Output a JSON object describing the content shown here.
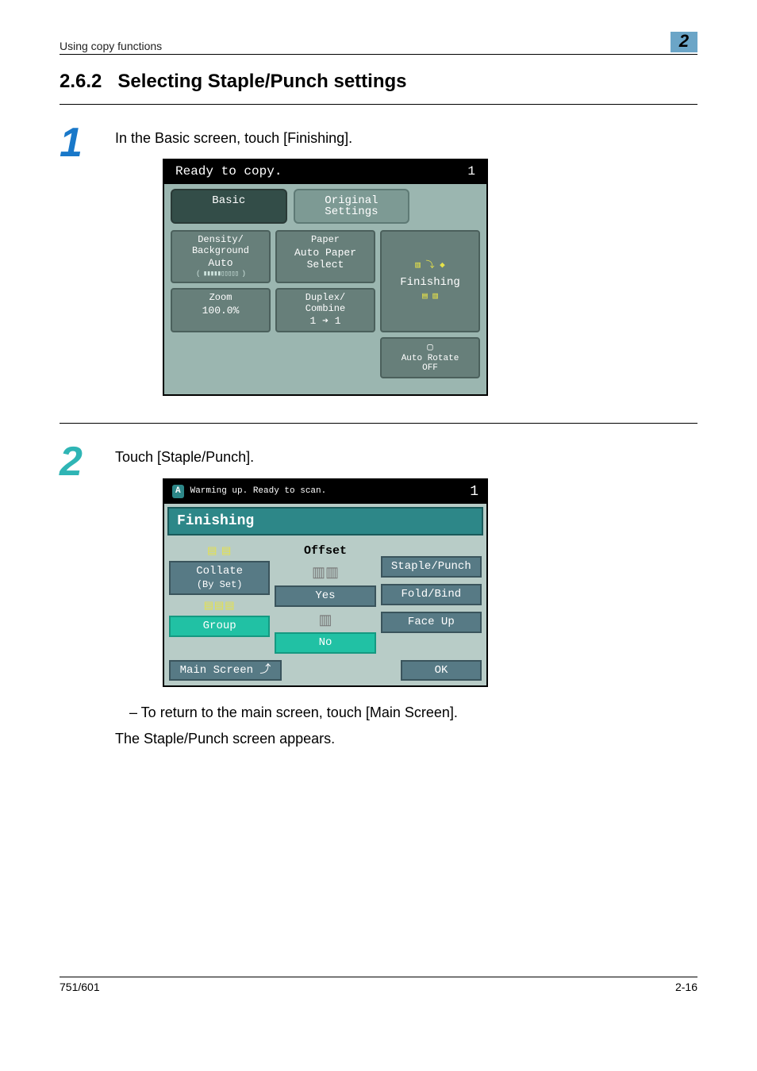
{
  "header": {
    "breadcrumb": "Using copy functions",
    "chapter_badge": "2"
  },
  "section": {
    "number": "2.6.2",
    "title": "Selecting Staple/Punch settings"
  },
  "step1": {
    "num": "1",
    "text": "In the Basic screen, touch [Finishing].",
    "panel": {
      "status": "Ready to copy.",
      "count": "1",
      "tabs": {
        "basic": "Basic",
        "original": "Original\nSettings"
      },
      "density_hd": "Density/\nBackground",
      "density_val": "Auto",
      "density_bar": "( ▮▮▮▮▮▯▯▯▯▯ )",
      "paper_hd": "Paper",
      "paper_val": "Auto Paper\nSelect",
      "finishing": "Finishing",
      "zoom_hd": "Zoom",
      "zoom_val": "100.0%",
      "duplex_hd": "Duplex/\nCombine",
      "duplex_val": "1  ➔  1",
      "autorotate": "Auto Rotate",
      "autorotate_state": "OFF"
    }
  },
  "step2": {
    "num": "2",
    "text": "Touch [Staple/Punch].",
    "panel": {
      "status": "Warming up. Ready to scan.",
      "count": "1",
      "title": "Finishing",
      "collate": "Collate",
      "byset": "(By Set)",
      "group": "Group",
      "offset": "Offset",
      "yes": "Yes",
      "no": "No",
      "staple": "Staple/Punch",
      "fold": "Fold/Bind",
      "faceup": "Face Up",
      "main": "Main Screen  ⤴",
      "ok": "OK"
    },
    "note1": "–  To return to the main screen, touch [Main Screen].",
    "note2": "The Staple/Punch screen appears."
  },
  "footer": {
    "left": "751/601",
    "right": "2-16"
  }
}
